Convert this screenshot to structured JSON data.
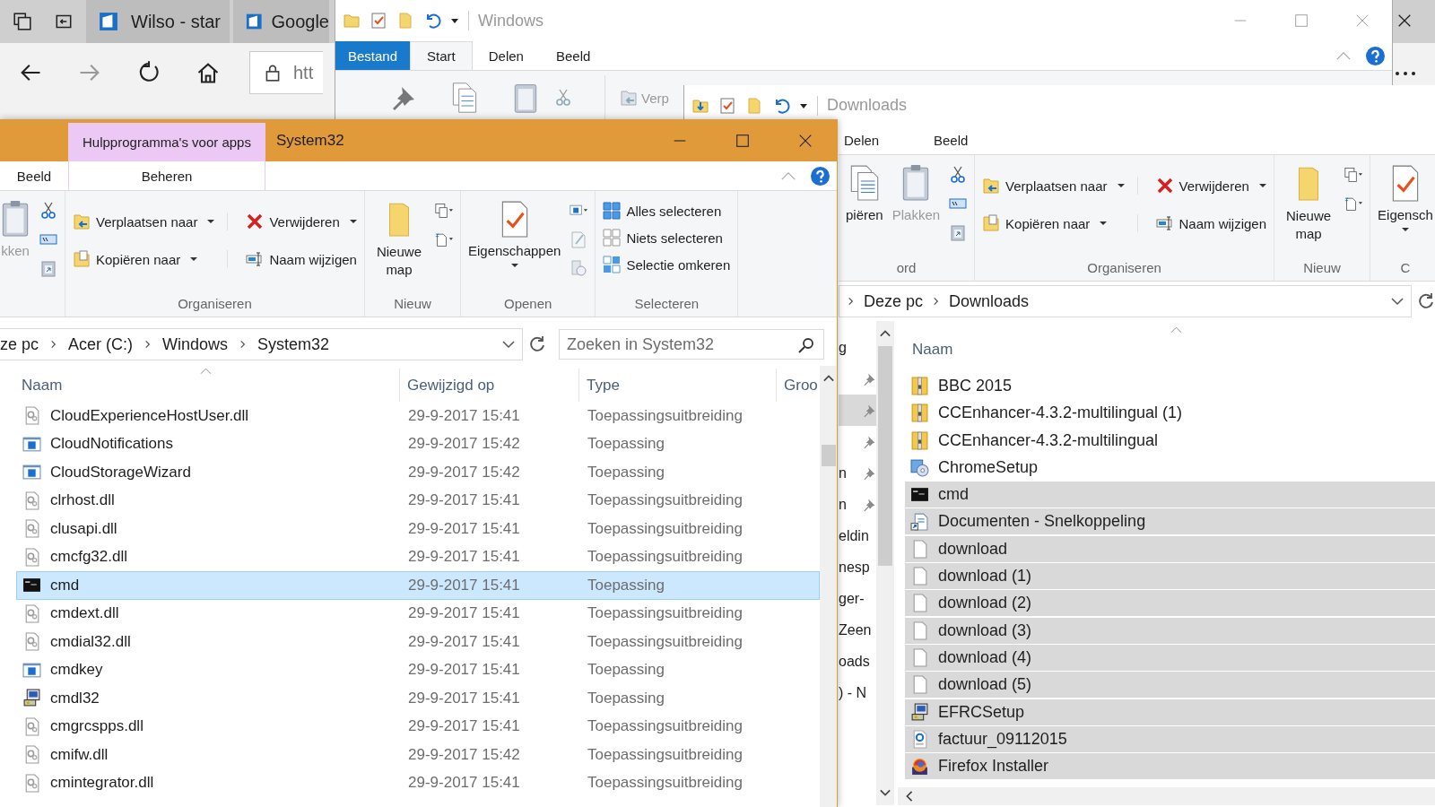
{
  "browser": {
    "tabs": [
      {
        "label": "Wilso - star",
        "selected": false
      },
      {
        "label": "Google",
        "selected": false
      }
    ],
    "address": "htt"
  },
  "windows_window": {
    "title": "Windows",
    "tabs": [
      {
        "label": "Bestand",
        "kind": "file",
        "selected": false
      },
      {
        "label": "Start",
        "kind": "tab",
        "selected": true
      },
      {
        "label": "Delen",
        "kind": "tab",
        "selected": false
      },
      {
        "label": "Beeld",
        "kind": "tab",
        "selected": false
      }
    ],
    "ribbon_text": "Verp"
  },
  "downloads_window": {
    "title": "Downloads",
    "tabs": [
      {
        "label": "Delen",
        "selected": false
      },
      {
        "label": "Beeld",
        "selected": false
      }
    ],
    "ribbon": [
      {
        "kind": "clipboard",
        "label": "ord",
        "items": [
          {
            "label": "piëren",
            "kind": "copy",
            "disabled": false
          },
          {
            "label": "Plakken",
            "kind": "paste",
            "disabled": true
          }
        ]
      },
      {
        "kind": "organize",
        "label": "Organiseren",
        "items": [
          "Verplaatsen naar",
          "Kopiëren naar",
          "Verwijderen",
          "Naam wijzigen"
        ]
      },
      {
        "kind": "new",
        "label": "Nieuw",
        "items": [
          "Nieuwe map"
        ]
      },
      {
        "kind": "properties",
        "label": "C",
        "items": [
          "Eigensch"
        ]
      }
    ],
    "breadcrumb": [
      "Deze pc",
      "Downloads"
    ],
    "nav_items": [
      {
        "text": "g",
        "pinned": false,
        "selected": false
      },
      {
        "pinned": true,
        "selected": false
      },
      {
        "pinned": true,
        "selected": true
      },
      {
        "pinned": true,
        "selected": false
      },
      {
        "text": "n",
        "pinned": true,
        "selected": false
      },
      {
        "text": "n",
        "pinned": true,
        "selected": false
      },
      {
        "text": "eldin",
        "pinned": false,
        "selected": false
      },
      {
        "text": "nesp",
        "pinned": false,
        "selected": false
      },
      {
        "text": "ger-",
        "pinned": false,
        "selected": false
      },
      {
        "text": "Zeen",
        "pinned": false,
        "selected": false
      },
      {
        "text": "oads",
        "pinned": false,
        "selected": false
      },
      {
        "text": ") - N",
        "pinned": false,
        "selected": false
      }
    ],
    "column": "Naam",
    "files": [
      {
        "name": "BBC 2015",
        "kind": "zip",
        "selected": false
      },
      {
        "name": "CCEnhancer-4.3.2-multilingual (1)",
        "kind": "zip",
        "selected": false
      },
      {
        "name": "CCEnhancer-4.3.2-multilingual",
        "kind": "zip",
        "selected": false
      },
      {
        "name": "ChromeSetup",
        "kind": "installer",
        "selected": false
      },
      {
        "name": "cmd",
        "kind": "cmd",
        "selected": true
      },
      {
        "name": "Documenten - Snelkoppeling",
        "kind": "shortcut",
        "selected": true
      },
      {
        "name": "download",
        "kind": "blank",
        "selected": true
      },
      {
        "name": "download (1)",
        "kind": "blank",
        "selected": true
      },
      {
        "name": "download (2)",
        "kind": "blank",
        "selected": true
      },
      {
        "name": "download (3)",
        "kind": "blank",
        "selected": true
      },
      {
        "name": "download (4)",
        "kind": "blank",
        "selected": true
      },
      {
        "name": "download (5)",
        "kind": "blank",
        "selected": true
      },
      {
        "name": "EFRCSetup",
        "kind": "computer",
        "selected": true
      },
      {
        "name": "factuur_09112015",
        "kind": "pdf",
        "selected": true
      },
      {
        "name": "Firefox Installer",
        "kind": "globe",
        "selected": true
      }
    ]
  },
  "system32_window": {
    "title": "System32",
    "context_tab": "Hulpprogramma's voor apps",
    "tabs": [
      {
        "label": "Beeld",
        "selected": false
      },
      {
        "label": "Beheren",
        "selected": false
      }
    ],
    "ribbon": [
      {
        "kind": "clipboard",
        "items": [
          {
            "label": "kken",
            "kind": "paste",
            "disabled": true
          }
        ]
      },
      {
        "kind": "organize",
        "label": "Organiseren",
        "items": [
          "Verplaatsen naar",
          "Kopiëren naar",
          "Verwijderen",
          "Naam wijzigen"
        ]
      },
      {
        "kind": "new",
        "label": "Nieuw",
        "items": [
          "Nieuwe map"
        ]
      },
      {
        "kind": "open",
        "label": "Openen",
        "items": [
          "Eigenschappen"
        ]
      },
      {
        "kind": "select",
        "label": "Selecteren",
        "items": [
          "Alles selecteren",
          "Niets selecteren",
          "Selectie omkeren"
        ]
      }
    ],
    "breadcrumb": [
      "ze pc",
      "Acer (C:)",
      "Windows",
      "System32"
    ],
    "search": {
      "placeholder": "Zoeken in System32"
    },
    "columns": [
      "Naam",
      "Gewijzigd op",
      "Type",
      "Groo"
    ],
    "rows": [
      {
        "name": "CloudExperienceHostUser.dll",
        "date": "29-9-2017 15:41",
        "type": "Toepassingsuitbreiding",
        "kind": "dll",
        "selected": false
      },
      {
        "name": "CloudNotifications",
        "date": "29-9-2017 15:42",
        "type": "Toepassing",
        "kind": "app",
        "selected": false
      },
      {
        "name": "CloudStorageWizard",
        "date": "29-9-2017 15:42",
        "type": "Toepassing",
        "kind": "app",
        "selected": false
      },
      {
        "name": "clrhost.dll",
        "date": "29-9-2017 15:41",
        "type": "Toepassingsuitbreiding",
        "kind": "dll",
        "selected": false
      },
      {
        "name": "clusapi.dll",
        "date": "29-9-2017 15:41",
        "type": "Toepassingsuitbreiding",
        "kind": "dll",
        "selected": false
      },
      {
        "name": "cmcfg32.dll",
        "date": "29-9-2017 15:41",
        "type": "Toepassingsuitbreiding",
        "kind": "dll",
        "selected": false
      },
      {
        "name": "cmd",
        "date": "29-9-2017 15:41",
        "type": "Toepassing",
        "kind": "cmd",
        "selected": true
      },
      {
        "name": "cmdext.dll",
        "date": "29-9-2017 15:41",
        "type": "Toepassingsuitbreiding",
        "kind": "dll",
        "selected": false
      },
      {
        "name": "cmdial32.dll",
        "date": "29-9-2017 15:41",
        "type": "Toepassingsuitbreiding",
        "kind": "dll",
        "selected": false
      },
      {
        "name": "cmdkey",
        "date": "29-9-2017 15:41",
        "type": "Toepassing",
        "kind": "app",
        "selected": false
      },
      {
        "name": "cmdl32",
        "date": "29-9-2017 15:41",
        "type": "Toepassing",
        "kind": "computer",
        "selected": false
      },
      {
        "name": "cmgrcspps.dll",
        "date": "29-9-2017 15:41",
        "type": "Toepassingsuitbreiding",
        "kind": "dll",
        "selected": false
      },
      {
        "name": "cmifw.dll",
        "date": "29-9-2017 15:42",
        "type": "Toepassingsuitbreiding",
        "kind": "dll",
        "selected": false
      },
      {
        "name": "cmintegrator.dll",
        "date": "29-9-2017 15:41",
        "type": "Toepassingsuitbreiding",
        "kind": "dll",
        "selected": false
      }
    ]
  }
}
